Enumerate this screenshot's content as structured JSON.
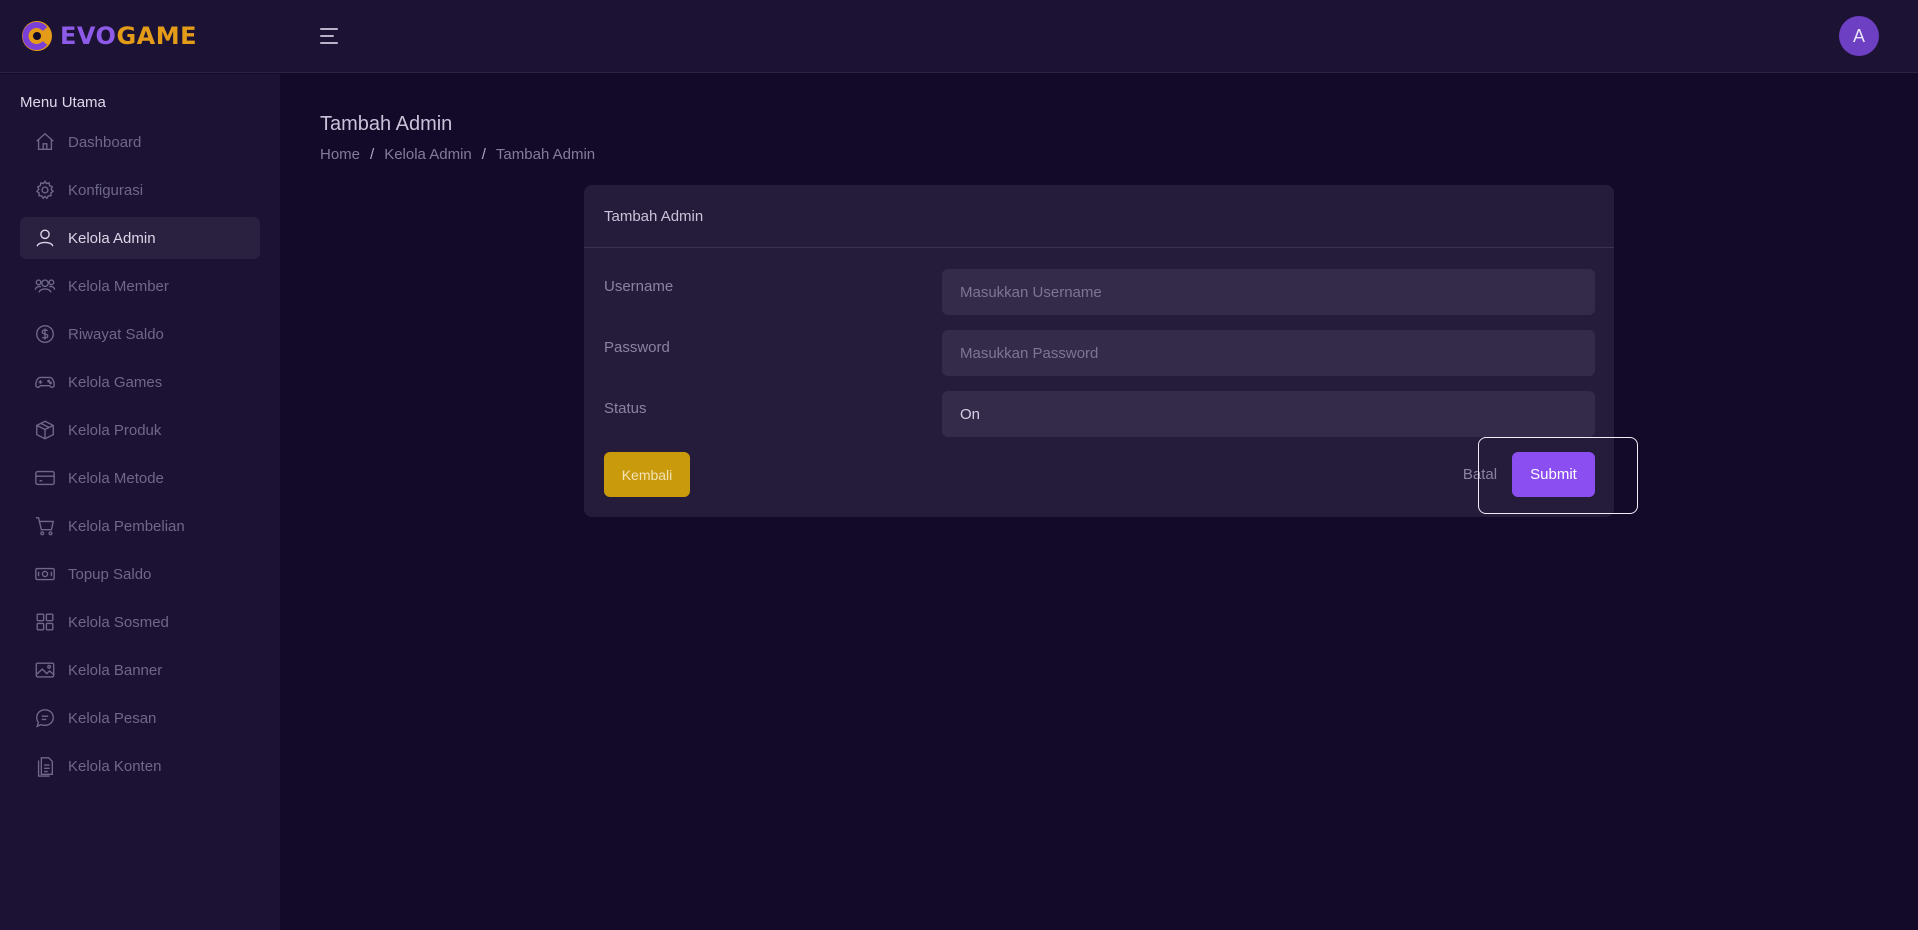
{
  "header": {
    "logo_part1": "EVO",
    "logo_part2": "GAME",
    "logo_icon": "game-logo-icon",
    "menu_icon": "hamburger-icon",
    "avatar_initial": "A"
  },
  "sidebar": {
    "heading": "Menu Utama",
    "items": [
      {
        "label": "Dashboard",
        "icon": "home-icon",
        "active": false
      },
      {
        "label": "Konfigurasi",
        "icon": "gear-icon",
        "active": false
      },
      {
        "label": "Kelola Admin",
        "icon": "user-icon",
        "active": true
      },
      {
        "label": "Kelola Member",
        "icon": "users-icon",
        "active": false
      },
      {
        "label": "Riwayat Saldo",
        "icon": "dollar-circle-icon",
        "active": false
      },
      {
        "label": "Kelola Games",
        "icon": "gamepad-icon",
        "active": false
      },
      {
        "label": "Kelola Produk",
        "icon": "box-icon",
        "active": false
      },
      {
        "label": "Kelola Metode",
        "icon": "credit-card-icon",
        "active": false
      },
      {
        "label": "Kelola Pembelian",
        "icon": "cart-icon",
        "active": false
      },
      {
        "label": "Topup Saldo",
        "icon": "cash-icon",
        "active": false
      },
      {
        "label": "Kelola Sosmed",
        "icon": "grid-icon",
        "active": false
      },
      {
        "label": "Kelola Banner",
        "icon": "image-icon",
        "active": false
      },
      {
        "label": "Kelola Pesan",
        "icon": "chat-icon",
        "active": false
      },
      {
        "label": "Kelola Konten",
        "icon": "document-icon",
        "active": false
      }
    ]
  },
  "page": {
    "title": "Tambah Admin",
    "breadcrumb": [
      "Home",
      "Kelola Admin",
      "Tambah Admin"
    ]
  },
  "form": {
    "title": "Tambah Admin",
    "username": {
      "label": "Username",
      "placeholder": "Masukkan Username",
      "value": ""
    },
    "password": {
      "label": "Password",
      "placeholder": "Masukkan Password",
      "value": ""
    },
    "status": {
      "label": "Status",
      "value": "On"
    },
    "back_label": "Kembali",
    "cancel_label": "Batal",
    "submit_label": "Submit"
  },
  "colors": {
    "background": "#130929",
    "panel": "#1c1233",
    "card": "#251b3b",
    "accent": "#8b4ef0",
    "warning": "#c99a0c"
  }
}
